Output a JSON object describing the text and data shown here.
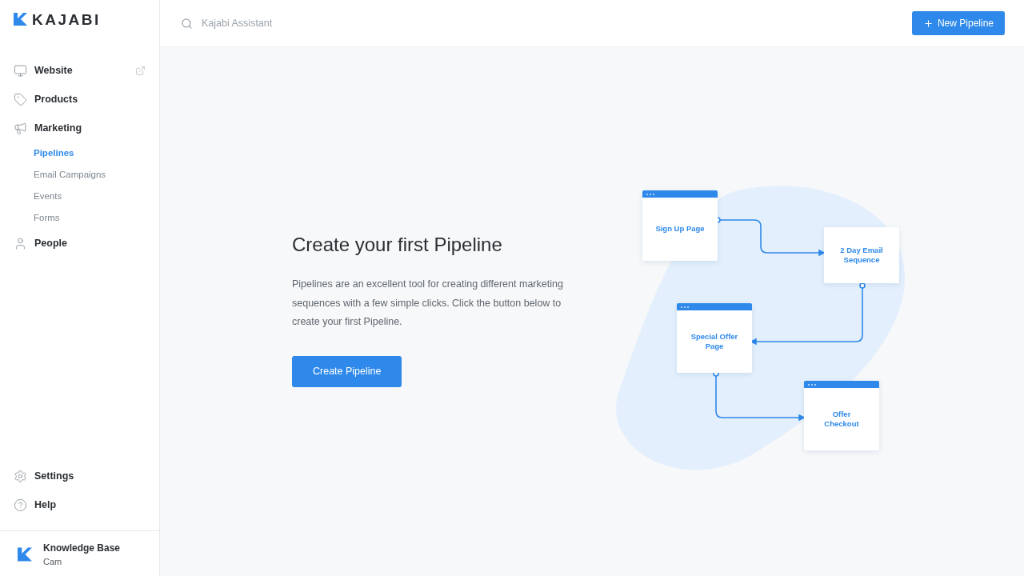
{
  "sidebar": {
    "logo": "KAJABI",
    "items": [
      {
        "label": "Website",
        "external": true,
        "selected": false
      },
      {
        "label": "Products",
        "external": false,
        "selected": false
      },
      {
        "label": "Marketing",
        "external": false,
        "selected": false,
        "children": [
          {
            "label": "Pipelines",
            "selected": true
          },
          {
            "label": "Email Campaigns",
            "selected": false
          },
          {
            "label": "Events",
            "selected": false
          },
          {
            "label": "Forms",
            "selected": false
          }
        ]
      },
      {
        "label": "People",
        "external": false,
        "selected": false
      }
    ],
    "bottom_items": [
      {
        "label": "Settings"
      },
      {
        "label": "Help"
      }
    ],
    "footer": {
      "title": "Knowledge Base",
      "subtitle": "Cam"
    }
  },
  "topbar": {
    "search": {
      "placeholder": "Kajabi Assistant"
    },
    "button": "New Pipeline"
  },
  "empty_state": {
    "title": "Create your first Pipeline",
    "description": "Pipelines are an excellent tool for creating different marketing sequences with a few simple clicks. Click the button below to create your first Pipeline.",
    "button": "Create Pipeline"
  },
  "diagram": {
    "nodes": [
      {
        "label": "Sign Up Page",
        "kind": "page"
      },
      {
        "label": "2 Day Email Sequence",
        "kind": "email"
      },
      {
        "label": "Special Offer Page",
        "kind": "page"
      },
      {
        "label": "Offer Checkout",
        "kind": "page"
      }
    ]
  }
}
